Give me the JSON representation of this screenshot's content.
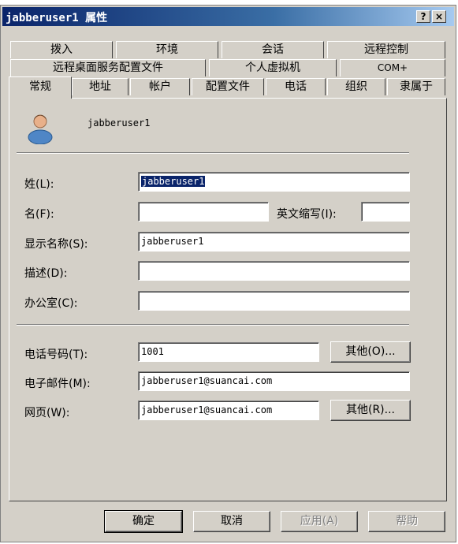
{
  "window": {
    "title": "jabberuser1 属性",
    "help_button": "?",
    "close_button": "×"
  },
  "tabs": {
    "row1": [
      "拨入",
      "环境",
      "会话",
      "远程控制"
    ],
    "row2": [
      "远程桌面服务配置文件",
      "个人虚拟机",
      "COM+"
    ],
    "row3": [
      "常规",
      "地址",
      "帐户",
      "配置文件",
      "电话",
      "组织",
      "隶属于"
    ],
    "active": "常规"
  },
  "general": {
    "display_user": "jabberuser1",
    "last_name_label": "姓(L):",
    "last_name_value": "jabberuser1",
    "first_name_label": "名(F):",
    "first_name_value": "",
    "initials_label": "英文缩写(I):",
    "initials_value": "",
    "display_name_label": "显示名称(S):",
    "display_name_value": "jabberuser1",
    "description_label": "描述(D):",
    "description_value": "",
    "office_label": "办公室(C):",
    "office_value": "",
    "phone_label": "电话号码(T):",
    "phone_value": "1001",
    "phone_other_button": "其他(O)...",
    "email_label": "电子邮件(M):",
    "email_value": "jabberuser1@suancai.com",
    "webpage_label": "网页(W):",
    "webpage_value": "jabberuser1@suancai.com",
    "webpage_other_button": "其他(R)..."
  },
  "footer": {
    "ok": "确定",
    "cancel": "取消",
    "apply": "应用(A)",
    "help": "帮助"
  }
}
